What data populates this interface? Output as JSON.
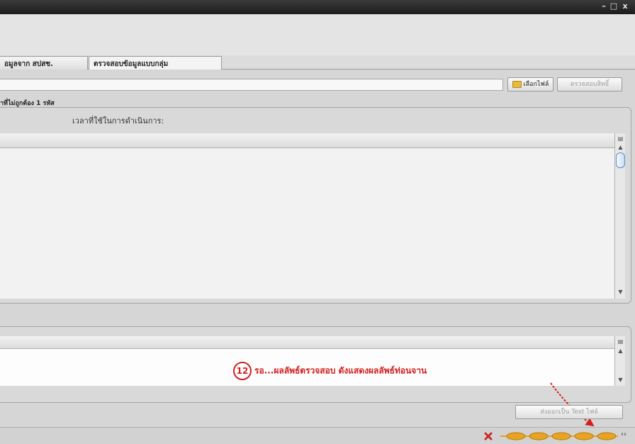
{
  "window": {
    "minimize": "–",
    "maximize": "□",
    "close": "x"
  },
  "tabs": [
    {
      "label": "อมูลจาก สปสช."
    },
    {
      "label": "ตรวจสอบข้อมูลแบบกลุ่ม"
    }
  ],
  "file_row": {
    "path_value": "",
    "choose_file_label": "เลือกไฟล์",
    "verify_label": "ตรวจสอบสิทธิ์"
  },
  "info_text": "าที่ไม่ถูกต้อง 1 รหัส",
  "processing": {
    "time_label": "เวลาที่ใช้ในการดำเนินการ:"
  },
  "annotation": {
    "number": "12",
    "text": "รอ...ผลลัพธ์ตรวจสอบ ดังแสดงผลลัพธ์ท่อนจาน"
  },
  "export_button": "ส่งออกเป็น Text ไฟล์",
  "progress": {
    "segments": 5
  },
  "colors": {
    "annotation": "#d21f1f",
    "progress": "#e8a320"
  }
}
